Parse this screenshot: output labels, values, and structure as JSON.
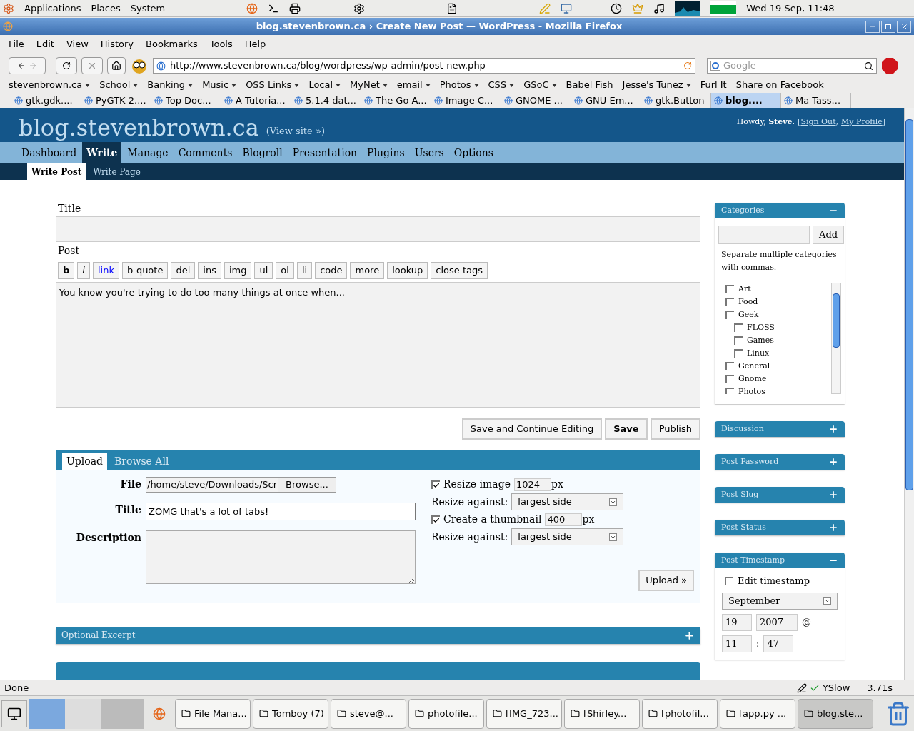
{
  "top_panel": {
    "menus": [
      "Applications",
      "Places",
      "System"
    ],
    "clock": "Wed 19 Sep, 11:48"
  },
  "window": {
    "title": "blog.stevenbrown.ca › Create New Post — WordPress - Mozilla Firefox"
  },
  "menubar": [
    "File",
    "Edit",
    "View",
    "History",
    "Bookmarks",
    "Tools",
    "Help"
  ],
  "navbar": {
    "url": "http://www.stevenbrown.ca/blog/wordpress/wp-admin/post-new.php",
    "search_placeholder": "Google"
  },
  "bookmarks": [
    {
      "label": "stevenbrown.ca",
      "folder": true
    },
    {
      "label": "School",
      "folder": true
    },
    {
      "label": "Banking",
      "folder": true
    },
    {
      "label": "Music",
      "folder": true
    },
    {
      "label": "OSS Links",
      "folder": true
    },
    {
      "label": "Local",
      "folder": true
    },
    {
      "label": "MyNet",
      "folder": true
    },
    {
      "label": "email",
      "folder": true
    },
    {
      "label": "Photos",
      "folder": true
    },
    {
      "label": "CSS",
      "folder": true
    },
    {
      "label": "GSoC",
      "folder": true
    },
    {
      "label": "Babel Fish",
      "folder": false
    },
    {
      "label": "Jesse's Tunez",
      "folder": true
    },
    {
      "label": "Furl It",
      "folder": false
    },
    {
      "label": "Share on Facebook",
      "folder": false
    }
  ],
  "tabs": [
    {
      "label": "gtk.gdk....",
      "selected": false
    },
    {
      "label": "PyGTK 2....",
      "selected": false
    },
    {
      "label": "Top Doc...",
      "selected": false
    },
    {
      "label": "A Tutoria...",
      "selected": false
    },
    {
      "label": "5.1.4 dat...",
      "selected": false
    },
    {
      "label": "The Go A...",
      "selected": false
    },
    {
      "label": "Image C...",
      "selected": false
    },
    {
      "label": "GNOME ...",
      "selected": false
    },
    {
      "label": "GNU Em...",
      "selected": false
    },
    {
      "label": "gtk.Button",
      "selected": false
    },
    {
      "label": "blog....",
      "selected": true
    },
    {
      "label": "Ma Tass...",
      "selected": false
    }
  ],
  "wp": {
    "site": "blog.stevenbrown.ca",
    "view_site": "(View site »)",
    "howdy": "Howdy, **Steve**.",
    "open_bracket": "[",
    "sign_out": "Sign Out",
    "comma": ",",
    "my_profile": "My Profile",
    "close_bracket": "]",
    "nav": [
      {
        "label": "Dashboard",
        "selected": false
      },
      {
        "label": "Write",
        "selected": true
      },
      {
        "label": "Manage",
        "selected": false
      },
      {
        "label": "Comments",
        "selected": false
      },
      {
        "label": "Blogroll",
        "selected": false
      },
      {
        "label": "Presentation",
        "selected": false
      },
      {
        "label": "Plugins",
        "selected": false
      },
      {
        "label": "Users",
        "selected": false
      },
      {
        "label": "Options",
        "selected": false
      }
    ],
    "subnav": [
      {
        "label": "Write Post",
        "selected": true
      },
      {
        "label": "Write Page",
        "selected": false
      }
    ]
  },
  "post": {
    "title_label": "Title",
    "post_label": "Post",
    "quicktags": [
      {
        "label": "b",
        "kind": "bold"
      },
      {
        "label": "i",
        "kind": "italic"
      },
      {
        "label": "link",
        "kind": "link"
      },
      {
        "label": "b-quote",
        "kind": "plain"
      },
      {
        "label": "del",
        "kind": "plain"
      },
      {
        "label": "ins",
        "kind": "plain"
      },
      {
        "label": "img",
        "kind": "plain"
      },
      {
        "label": "ul",
        "kind": "plain"
      },
      {
        "label": "ol",
        "kind": "plain"
      },
      {
        "label": "li",
        "kind": "plain"
      },
      {
        "label": "code",
        "kind": "plain"
      },
      {
        "label": "more",
        "kind": "plain"
      },
      {
        "label": "lookup",
        "kind": "plain"
      },
      {
        "label": "close tags",
        "kind": "plain"
      }
    ],
    "body": "You know you're trying to do too many things at once when...",
    "buttons": [
      {
        "label": "Save and Continue Editing",
        "kind": "plain"
      },
      {
        "label": "Save",
        "kind": "bold"
      },
      {
        "label": "Publish",
        "kind": "plain"
      }
    ]
  },
  "upload": {
    "tabs": [
      {
        "label": "Upload",
        "selected": true
      },
      {
        "label": "Browse All",
        "selected": false
      }
    ],
    "file_label": "File",
    "file_value": "/home/steve/Downloads/Scr",
    "browse": "Browse...",
    "title_label": "Title",
    "title_value": "ZOMG that's a lot of tabs!",
    "description_label": "Description",
    "resize_image": {
      "label": "Resize image",
      "checked": true,
      "value": "1024",
      "unit": "px"
    },
    "resize_against_1": {
      "label": "Resize against:",
      "value": "largest side"
    },
    "thumbnail": {
      "label": "Create a thumbnail",
      "checked": true,
      "value": "400",
      "unit": "px"
    },
    "resize_against_2": {
      "label": "Resize against:",
      "value": "largest side"
    },
    "button": "Upload »"
  },
  "panels": [
    {
      "title": "Optional Excerpt",
      "expanded": false
    }
  ],
  "sidebar": [
    {
      "title": "Categories",
      "expanded": true,
      "kind": "categories"
    },
    {
      "title": "Discussion",
      "expanded": false,
      "kind": "plain"
    },
    {
      "title": "Post Password",
      "expanded": false,
      "kind": "plain"
    },
    {
      "title": "Post Slug",
      "expanded": false,
      "kind": "plain"
    },
    {
      "title": "Post Status",
      "expanded": false,
      "kind": "plain"
    },
    {
      "title": "Post Timestamp",
      "expanded": true,
      "kind": "timestamp"
    }
  ],
  "categories": {
    "add": "Add",
    "hint": "Separate multiple categories with commas.",
    "items": [
      {
        "label": "Art",
        "checked": false
      },
      {
        "label": "Food",
        "checked": false
      },
      {
        "label": "Geek",
        "checked": false,
        "children": [
          {
            "label": "FLOSS",
            "checked": false
          },
          {
            "label": "Games",
            "checked": false
          },
          {
            "label": "Linux",
            "checked": false
          }
        ]
      },
      {
        "label": "General",
        "checked": false
      },
      {
        "label": "Gnome",
        "checked": false
      },
      {
        "label": "Photos",
        "checked": false
      }
    ]
  },
  "timestamp": {
    "label": "Edit timestamp",
    "checked": false,
    "month": "September",
    "day": "19",
    "year": "2007",
    "at": "@",
    "hour": "11",
    "colon": ":",
    "minute": "47"
  },
  "status_bar": {
    "text": "Done",
    "yslow": "YSlow",
    "time": "3.71s"
  },
  "taskbar": [
    {
      "label": "File Mana...",
      "selected": false
    },
    {
      "label": "Tomboy (7)",
      "selected": false
    },
    {
      "label": "steve@...",
      "selected": false
    },
    {
      "label": "photofile...",
      "selected": false
    },
    {
      "label": "[IMG_723...",
      "selected": false
    },
    {
      "label": "[Shirley...",
      "selected": false
    },
    {
      "label": "[photofil...",
      "selected": false
    },
    {
      "label": "[app.py ...",
      "selected": false
    },
    {
      "label": "blog.ste...",
      "selected": true
    }
  ]
}
